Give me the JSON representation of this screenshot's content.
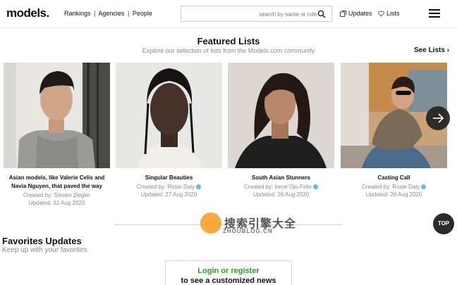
{
  "header": {
    "logo": "models.",
    "nav": [
      "Rankings",
      "Agencies",
      "People"
    ],
    "nav_sep": "|",
    "search_placeholder": "search by name or role",
    "updates_label": "Updates",
    "lists_label": "Lists"
  },
  "featured": {
    "title": "Featured Lists",
    "subtitle": "Explore our selection of lists from the Models.com community",
    "see_lists": "See Lists",
    "cards": [
      {
        "title_line1": "Asian models, like Valerie Celis and",
        "title_line2": "Navia Nguyen, that paved the way",
        "created_by": "Created by: Steven Ziegler",
        "updated": "Updated: 31 Aug 2020",
        "verified": false
      },
      {
        "title_line1": "Singular Beauties",
        "title_line2": "",
        "created_by": "Created by: Rosie Daly",
        "updated": "Updated: 27 Aug 2020",
        "verified": true
      },
      {
        "title_line1": "South Asian Stunners",
        "title_line2": "",
        "created_by": "Created by: Irene Ojo-Felix",
        "updated": "Updated: 26 Aug 2020",
        "verified": true
      },
      {
        "title_line1": "Casting Call",
        "title_line2": "",
        "created_by": "Created by: Rosie Daly",
        "updated": "Updated: 26 Aug 2020",
        "verified": true
      }
    ]
  },
  "top_button": "TOP",
  "favorites": {
    "title": "Favorites Updates",
    "subtitle": "Keep up with your favorites",
    "login_link": "Login or register",
    "login_text": "to see a customized news"
  },
  "watermark": {
    "text": "搜索引擎大全",
    "url": "ZHOUBLOG.CN"
  },
  "colors": {
    "login_green": "#27a11f",
    "verified_blue": "#6ab6e6",
    "muted_text": "#8a8a8a"
  },
  "icons": [
    "search-icon",
    "updates-icon",
    "heart-icon",
    "hamburger-icon",
    "arrow-right-icon",
    "verified-icon"
  ]
}
